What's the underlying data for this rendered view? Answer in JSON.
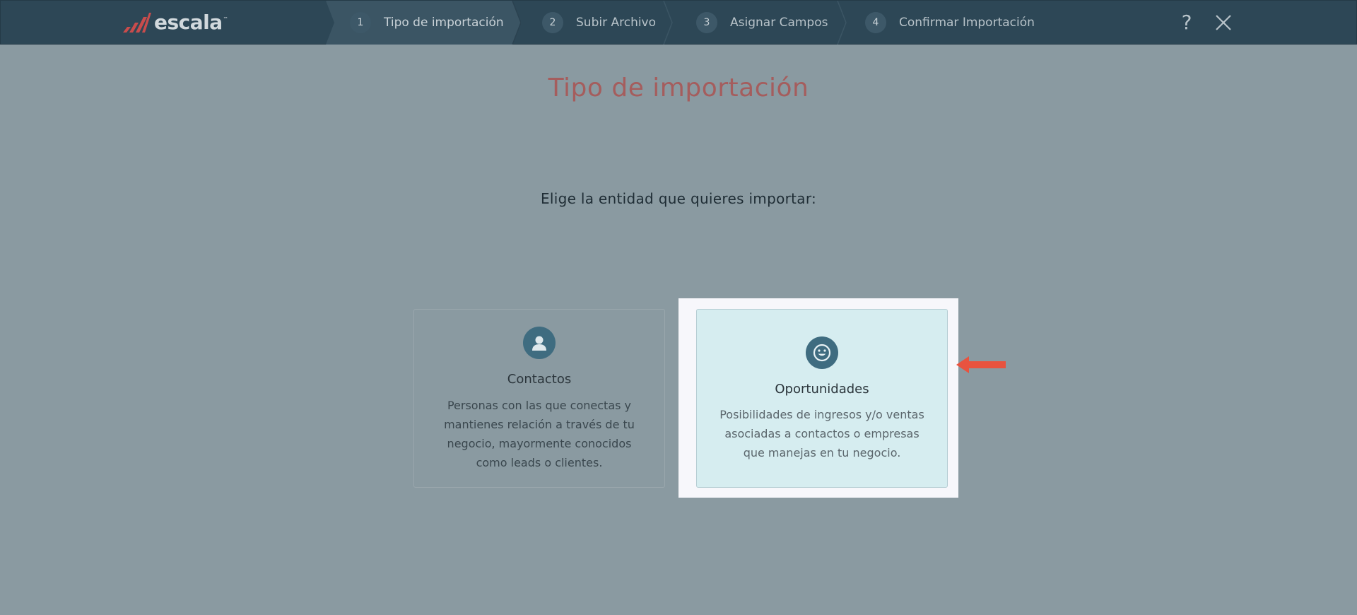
{
  "header": {
    "logo_text": "escala",
    "logo_tm": "™",
    "steps": [
      {
        "num": "1",
        "label": "Tipo de importación"
      },
      {
        "num": "2",
        "label": "Subir Archivo"
      },
      {
        "num": "3",
        "label": "Asignar Campos"
      },
      {
        "num": "4",
        "label": "Confirmar Importación"
      }
    ],
    "help_glyph": "?",
    "icons": [
      "logo-bars-icon",
      "help-icon",
      "close-icon"
    ]
  },
  "main": {
    "title": "Tipo de importación",
    "subtitle": "Elige la entidad que quieres importar:",
    "cards": [
      {
        "title": "Contactos",
        "description": "Personas con las que conectas y mantienes relación a través de tu negocio, mayormente conocidos como leads o clientes.",
        "icon": "person-icon"
      },
      {
        "title": "Oportunidades",
        "description": "Posibilidades de ingresos y/o ventas asociadas a contactos o empresas que manejas en tu negocio.",
        "icon": "smiley-icon",
        "highlighted": true
      }
    ]
  },
  "colors": {
    "topbar": "#2d4756",
    "overlay": "#8a9aa1",
    "title": "#a55d5d",
    "card_icon": "#3f6c80",
    "highlight_card": "#d6edf0",
    "arrow": "#e8533f"
  }
}
